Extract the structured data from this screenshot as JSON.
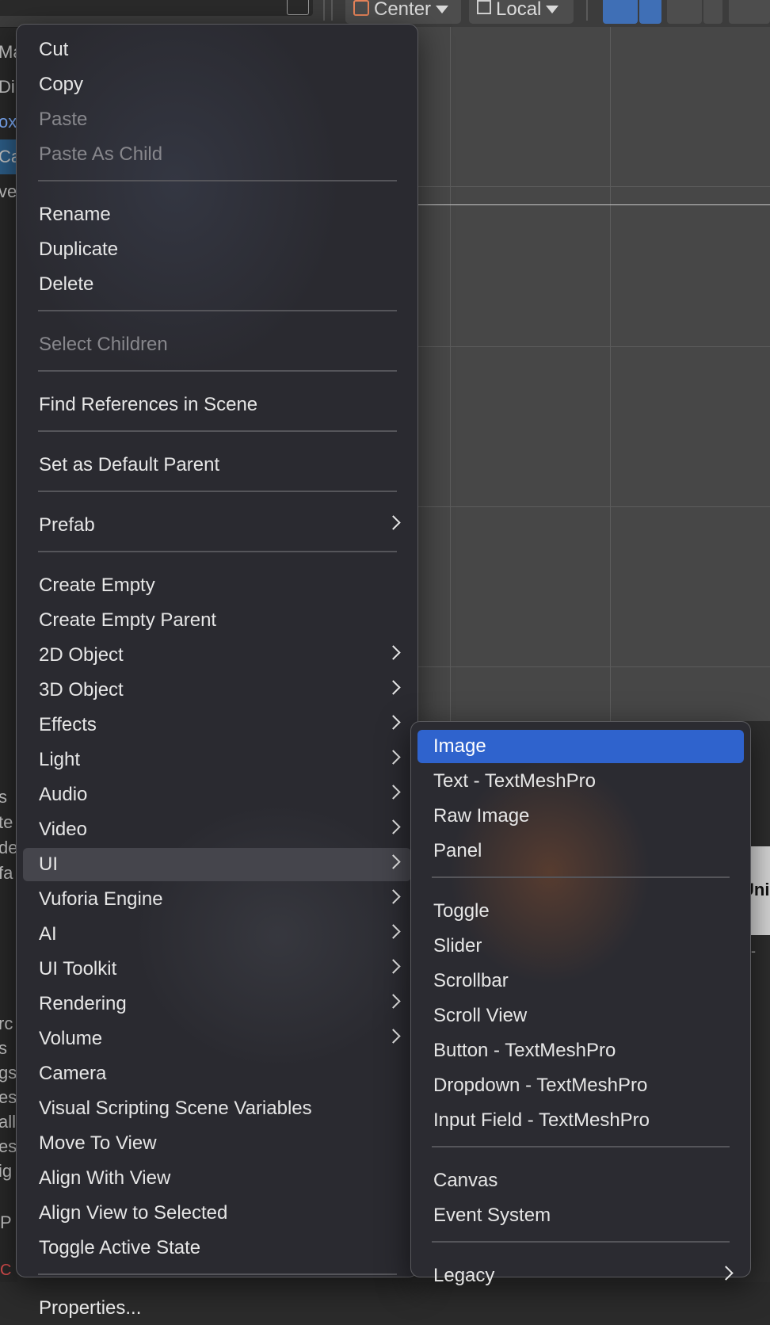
{
  "background": {
    "hierarchy_rows": [
      {
        "text": "Ma",
        "style": ""
      },
      {
        "text": "Dir",
        "style": ""
      },
      {
        "text": "ox",
        "style": "blue"
      },
      {
        "text": "Ca",
        "style": "sel"
      },
      {
        "text": "ve",
        "style": ""
      }
    ],
    "lower_rows": [
      "s",
      "te",
      "de",
      "fa"
    ],
    "bottom_rows": [
      "rc",
      "s",
      "gs",
      "es",
      "all",
      "es",
      "ig"
    ],
    "footer_row": "P",
    "footer_red": "C",
    "asterisk": "*",
    "toolbar": {
      "pivot_label": "Center",
      "space_label": "Local"
    },
    "bottom_strip_label": "Uni",
    "small_text": "ty-"
  },
  "main_menu": {
    "items": [
      {
        "label": "Cut",
        "disabled": false,
        "submenu": false
      },
      {
        "label": "Copy",
        "disabled": false,
        "submenu": false
      },
      {
        "label": "Paste",
        "disabled": true,
        "submenu": false
      },
      {
        "label": "Paste As Child",
        "disabled": true,
        "submenu": false
      },
      {
        "separator": true
      },
      {
        "label": "Rename",
        "disabled": false,
        "submenu": false
      },
      {
        "label": "Duplicate",
        "disabled": false,
        "submenu": false
      },
      {
        "label": "Delete",
        "disabled": false,
        "submenu": false
      },
      {
        "separator": true
      },
      {
        "label": "Select Children",
        "disabled": true,
        "submenu": false
      },
      {
        "separator": true
      },
      {
        "label": "Find References in Scene",
        "disabled": false,
        "submenu": false
      },
      {
        "separator": true
      },
      {
        "label": "Set as Default Parent",
        "disabled": false,
        "submenu": false
      },
      {
        "separator": true
      },
      {
        "label": "Prefab",
        "disabled": false,
        "submenu": true
      },
      {
        "separator": true
      },
      {
        "label": "Create Empty",
        "disabled": false,
        "submenu": false
      },
      {
        "label": "Create Empty Parent",
        "disabled": false,
        "submenu": false
      },
      {
        "label": "2D Object",
        "disabled": false,
        "submenu": true
      },
      {
        "label": "3D Object",
        "disabled": false,
        "submenu": true
      },
      {
        "label": "Effects",
        "disabled": false,
        "submenu": true
      },
      {
        "label": "Light",
        "disabled": false,
        "submenu": true
      },
      {
        "label": "Audio",
        "disabled": false,
        "submenu": true
      },
      {
        "label": "Video",
        "disabled": false,
        "submenu": true
      },
      {
        "label": "UI",
        "disabled": false,
        "submenu": true,
        "hover": true
      },
      {
        "label": "Vuforia Engine",
        "disabled": false,
        "submenu": true
      },
      {
        "label": "AI",
        "disabled": false,
        "submenu": true
      },
      {
        "label": "UI Toolkit",
        "disabled": false,
        "submenu": true
      },
      {
        "label": "Rendering",
        "disabled": false,
        "submenu": true
      },
      {
        "label": "Volume",
        "disabled": false,
        "submenu": true
      },
      {
        "label": "Camera",
        "disabled": false,
        "submenu": false
      },
      {
        "label": "Visual Scripting Scene Variables",
        "disabled": false,
        "submenu": false
      },
      {
        "label": "Move To View",
        "disabled": false,
        "submenu": false
      },
      {
        "label": "Align With View",
        "disabled": false,
        "submenu": false
      },
      {
        "label": "Align View to Selected",
        "disabled": false,
        "submenu": false
      },
      {
        "label": "Toggle Active State",
        "disabled": false,
        "submenu": false
      },
      {
        "separator": true
      },
      {
        "label": "Properties...",
        "disabled": false,
        "submenu": false
      }
    ]
  },
  "ui_submenu": {
    "items": [
      {
        "label": "Image",
        "selected": true,
        "submenu": false
      },
      {
        "label": "Text - TextMeshPro",
        "submenu": false
      },
      {
        "label": "Raw Image",
        "submenu": false
      },
      {
        "label": "Panel",
        "submenu": false
      },
      {
        "separator": true
      },
      {
        "label": "Toggle",
        "submenu": false
      },
      {
        "label": "Slider",
        "submenu": false
      },
      {
        "label": "Scrollbar",
        "submenu": false
      },
      {
        "label": "Scroll View",
        "submenu": false
      },
      {
        "label": "Button - TextMeshPro",
        "submenu": false
      },
      {
        "label": "Dropdown - TextMeshPro",
        "submenu": false
      },
      {
        "label": "Input Field - TextMeshPro",
        "submenu": false
      },
      {
        "separator": true
      },
      {
        "label": "Canvas",
        "submenu": false
      },
      {
        "label": "Event System",
        "submenu": false
      },
      {
        "separator": true
      },
      {
        "label": "Legacy",
        "submenu": true
      }
    ]
  }
}
